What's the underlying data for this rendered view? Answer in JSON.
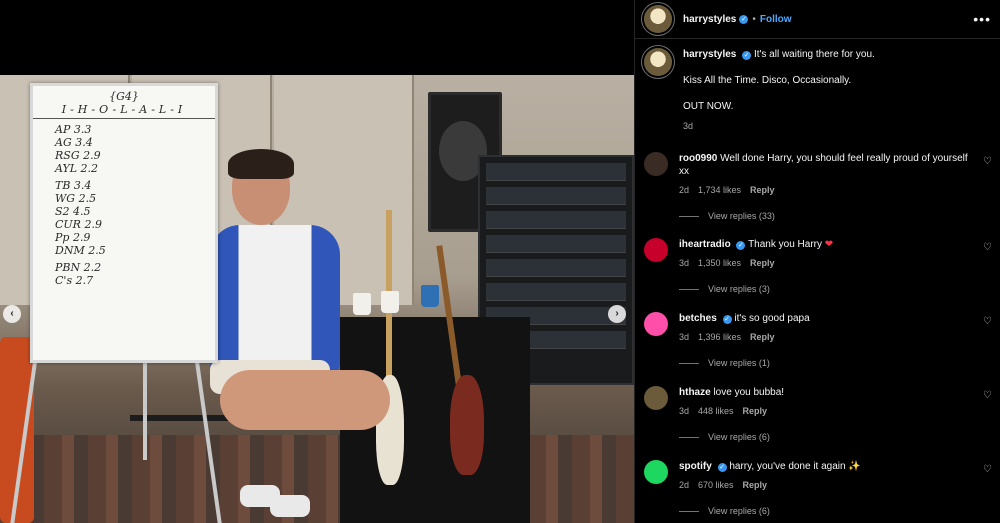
{
  "post": {
    "author": "harrystyles",
    "follow_label": "Follow",
    "more_label": "•••",
    "caption_lines": [
      "It's all waiting there for you.",
      "Kiss All the Time. Disco, Occasionally.",
      "OUT NOW."
    ],
    "time": "3d"
  },
  "media": {
    "prev_arrow": "‹",
    "next_arrow": "›",
    "whiteboard": {
      "title_top": "{G4}",
      "title": "I-H-O-L-A-L-I",
      "lines": [
        "AP 3.3",
        "AG 3.4",
        "RSG 2.9",
        "AYL 2.2",
        "TB 3.4",
        "WG 2.5",
        "S2 4.5",
        "CUR 2.9",
        "Pp 2.9",
        "DNM 2.5",
        "PBN 2.2",
        "C's 2.7"
      ]
    }
  },
  "comments": [
    {
      "user": "roo0990",
      "verified": false,
      "text": "Well done Harry, you should feel really proud of yourself xx",
      "time": "2d",
      "likes": "1,734 likes",
      "reply": "Reply",
      "view_replies": "View replies (33)",
      "avatar_color": "#3a2c24"
    },
    {
      "user": "iheartradio",
      "verified": true,
      "text": "Thank you Harry",
      "emoji": "❤",
      "time": "3d",
      "likes": "1,350 likes",
      "reply": "Reply",
      "view_replies": "View replies (3)",
      "avatar_color": "#c6002b"
    },
    {
      "user": "betches",
      "verified": true,
      "text": "it's so good papa",
      "time": "3d",
      "likes": "1,396 likes",
      "reply": "Reply",
      "view_replies": "View replies (1)",
      "avatar_color": "#ff4fa8"
    },
    {
      "user": "hthaze",
      "verified": false,
      "text": "love you bubba!",
      "time": "3d",
      "likes": "448 likes",
      "reply": "Reply",
      "view_replies": "View replies (6)",
      "avatar_color": "#6b5b3a"
    },
    {
      "user": "spotify",
      "verified": true,
      "text": "harry, you've done it again",
      "emoji": "✨",
      "time": "2d",
      "likes": "670 likes",
      "reply": "Reply",
      "view_replies": "View replies (6)",
      "avatar_color": "#1ed760"
    }
  ],
  "icons": {
    "heart": "♡",
    "verified": "✓"
  },
  "colors": {
    "accent_link": "#4ea8ff",
    "verified": "#3897f0",
    "muted": "#a8a8a8"
  }
}
